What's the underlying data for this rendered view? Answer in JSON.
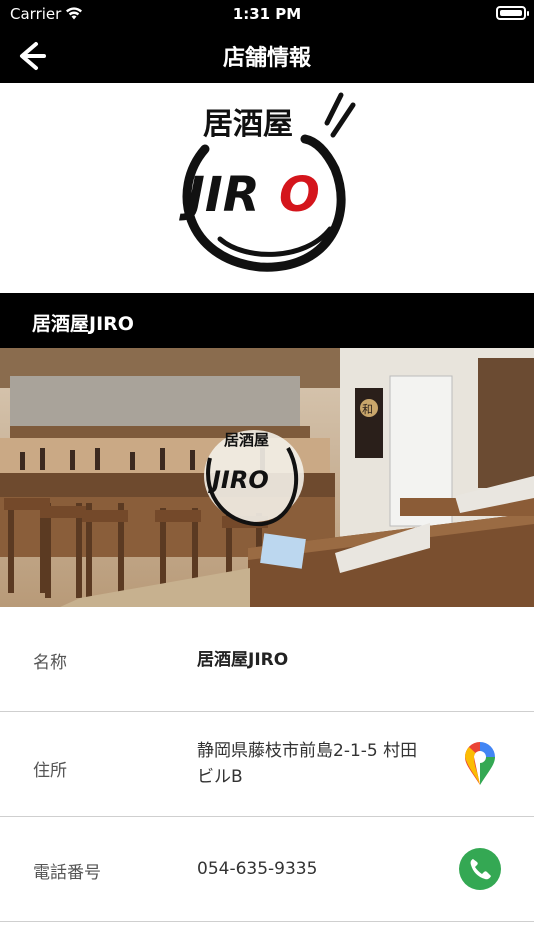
{
  "status_bar": {
    "carrier": "Carrier",
    "time": "1:31 PM"
  },
  "navbar": {
    "title": "店舗情報"
  },
  "logo": {
    "text_top": "居酒屋",
    "text_main_black": "JIR",
    "text_main_red": "O"
  },
  "store": {
    "name": "居酒屋JIRO"
  },
  "photo": {
    "sign_top": "居酒屋",
    "sign_main": "JIRO",
    "noren": "和"
  },
  "info": {
    "name_label": "名称",
    "name_value": "居酒屋JIRO",
    "address_label": "住所",
    "address_value_line1": "静岡県藤枝市前島2-1-5 村田",
    "address_value_line2": "ビルB",
    "phone_label": "電話番号",
    "phone_value": "054-635-9335"
  },
  "colors": {
    "bar_bg": "#000000",
    "phone_green": "#34A853",
    "logo_red": "#D4151C"
  },
  "icons": {
    "back": "arrow-left-icon",
    "map": "google-maps-pin-icon",
    "phone": "phone-icon",
    "wifi": "wifi-icon",
    "battery": "battery-icon"
  }
}
